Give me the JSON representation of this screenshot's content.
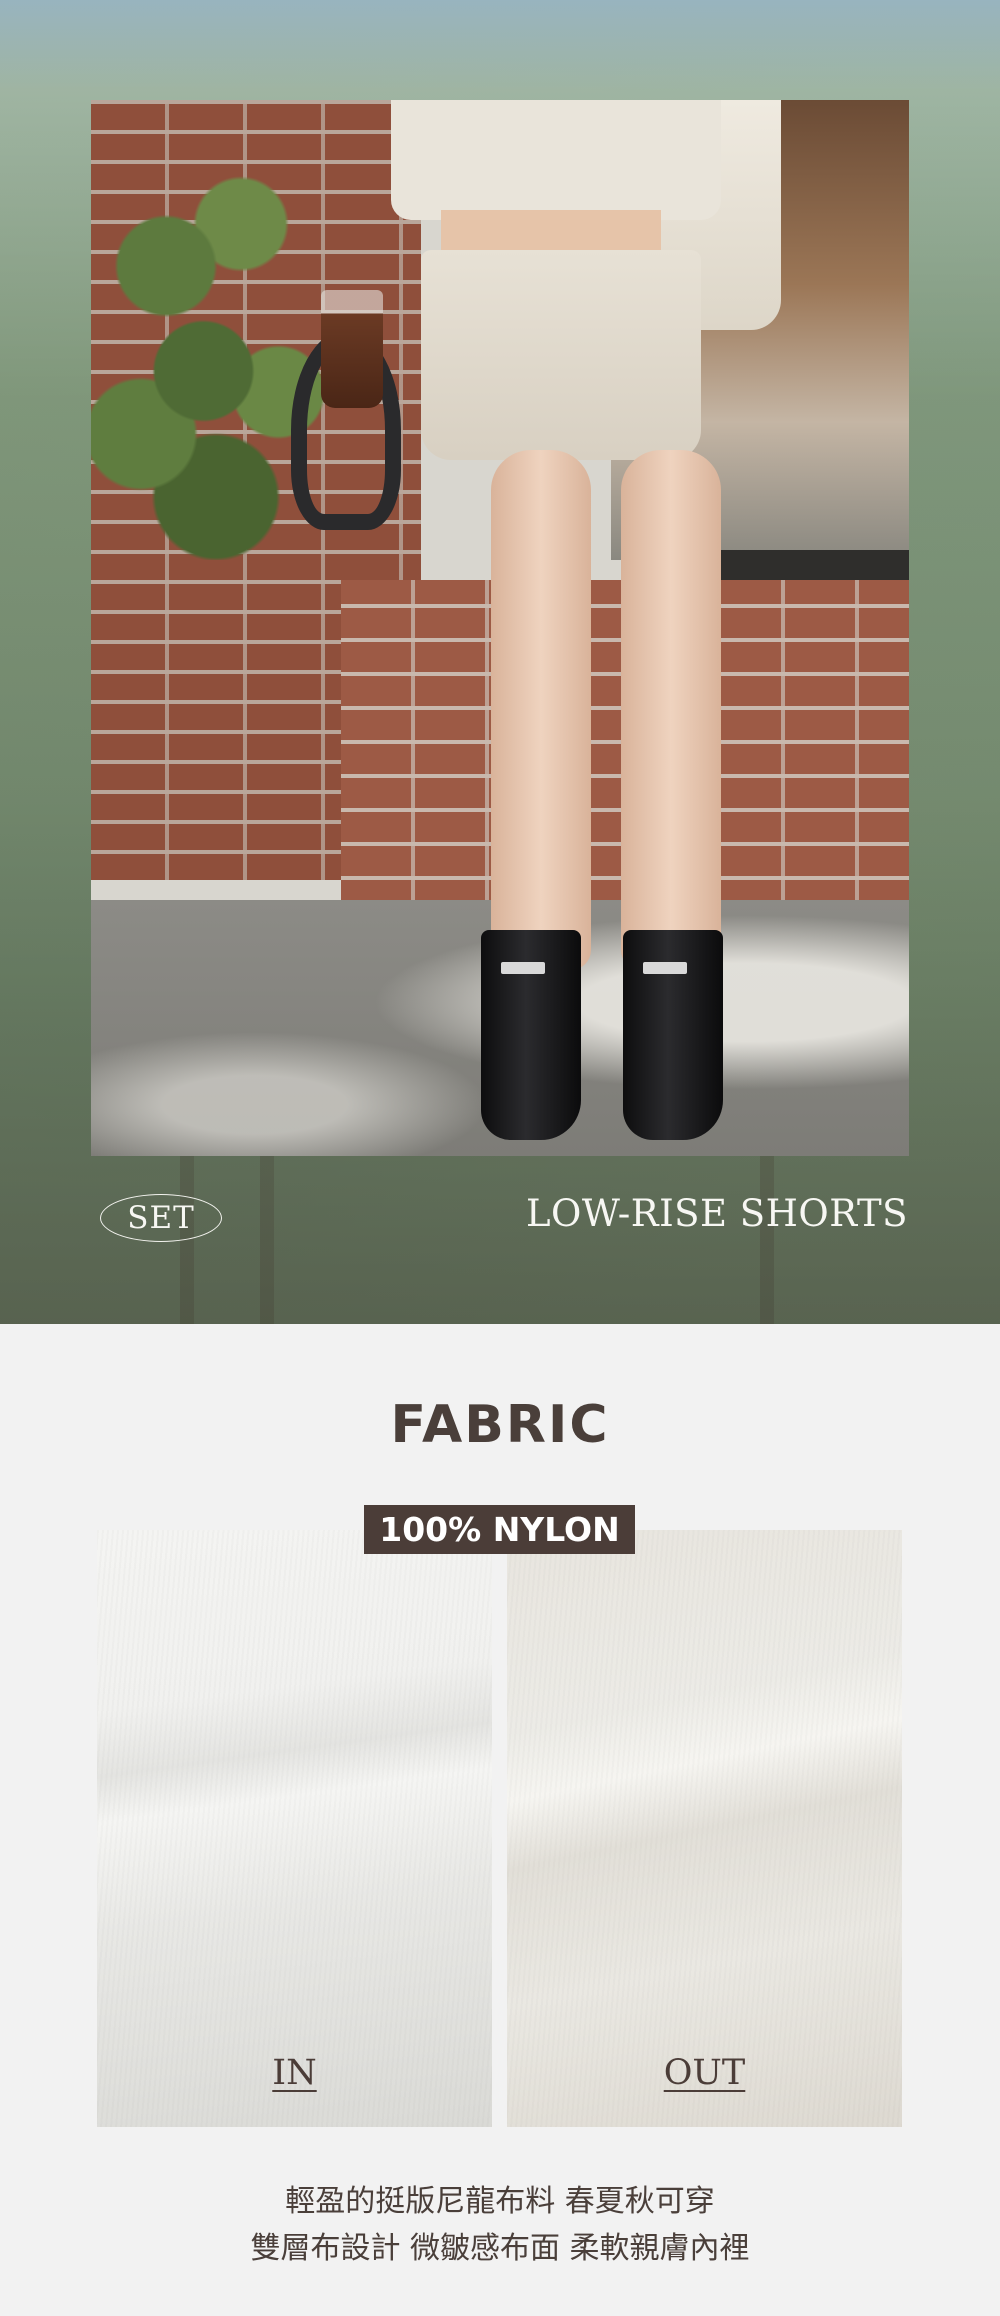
{
  "hero": {
    "set_label": "SET",
    "title": "LOW-RISE SHORTS"
  },
  "fabric": {
    "heading": "FABRIC",
    "badge": "100% NYLON",
    "swatches": [
      {
        "label": "IN"
      },
      {
        "label": "OUT"
      }
    ],
    "description": [
      "輕盈的挺版尼龍布料 春夏秋可穿",
      "雙層布設計 微皺感布面 柔軟親膚內裡"
    ]
  }
}
